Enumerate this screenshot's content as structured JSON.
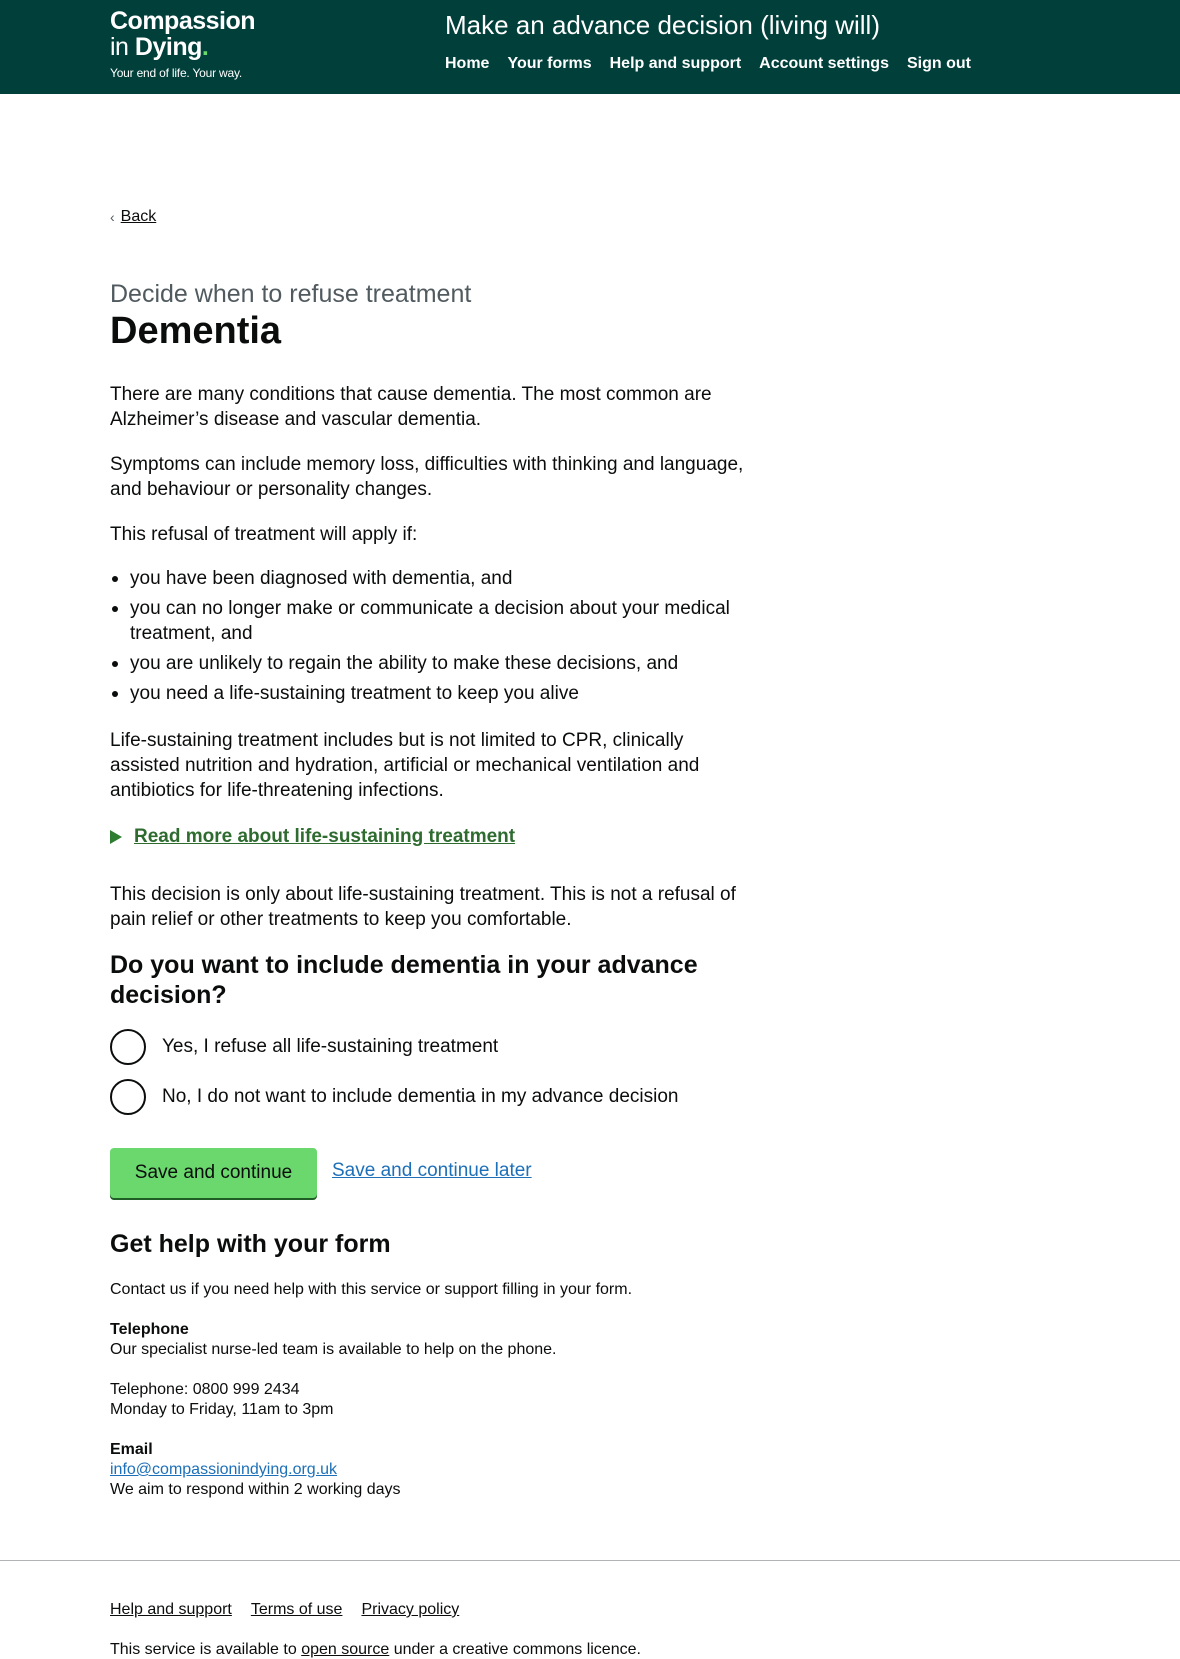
{
  "brand": {
    "line1": "Compassion",
    "line2_prefix": "in",
    "line2_bold": "Dying",
    "dot": ".",
    "tagline": "Your end of life. Your way."
  },
  "header": {
    "service_name": "Make an advance decision (living will)",
    "nav": [
      "Home",
      "Your forms",
      "Help and support",
      "Account settings",
      "Sign out"
    ]
  },
  "back_link": "Back",
  "page": {
    "caption": "Decide when to refuse treatment",
    "title": "Dementia",
    "para1": "There are many conditions that cause dementia. The most common are Alzheimer’s disease and vascular dementia.",
    "para2": "Symptoms can include memory loss, difficulties with thinking and language, and behaviour or personality changes.",
    "para3": "This refusal of treatment will apply if:",
    "bullets": [
      "you have been diagnosed with dementia, and",
      "you can no longer make or communicate a decision about your medical treatment, and",
      "you are unlikely to regain the ability to make these decisions, and",
      "you need a life-sustaining treatment to keep you alive"
    ],
    "para4": "Life-sustaining treatment includes but is not limited to CPR, clinically assisted nutrition and hydration, artificial or mechanical ventilation and antibiotics for life-threatening infections.",
    "details_summary": "Read more about life-sustaining treatment",
    "para5": "This decision is only about life-sustaining treatment. This is not a refusal of pain relief or other treatments to keep you comfortable."
  },
  "question": {
    "text": "Do you want to include dementia in your advance decision?",
    "options": [
      "Yes, I refuse all life-sustaining treatment",
      "No, I do not want to include dementia in my advance decision"
    ]
  },
  "actions": {
    "save_continue": "Save and continue",
    "save_later": "Save and continue later"
  },
  "help": {
    "title": "Get help with your form",
    "intro": "Contact us if you need help with this service or support filling in your form.",
    "telephone_heading": "Telephone",
    "telephone_desc": "Our specialist nurse-led team is available to help on the phone.",
    "telephone_number": "Telephone: 0800 999 2434",
    "telephone_hours": "Monday to Friday, 11am to 3pm",
    "email_heading": "Email",
    "email_address": "info@compassionindying.org.uk",
    "email_note": "We aim to respond within 2 working days"
  },
  "footer": {
    "links": [
      "Help and support",
      "Terms of use",
      "Privacy policy"
    ],
    "licence_prefix": "This service is available to",
    "licence_link": "open source",
    "licence_suffix": "under a creative commons licence."
  },
  "colors": {
    "header_bg": "#003f3a",
    "brand_green": "#6bd86e",
    "link_blue": "#1d70b8",
    "details_green": "#2e6b2f"
  }
}
